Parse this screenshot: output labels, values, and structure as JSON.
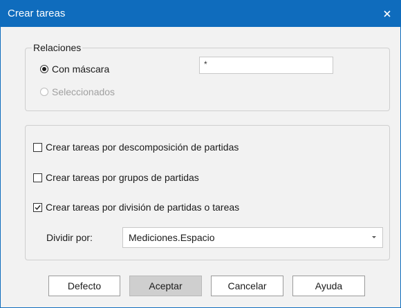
{
  "window": {
    "title": "Crear tareas",
    "close_icon": "close-icon",
    "titlebar_color": "#0f6cbd"
  },
  "relaciones": {
    "legend": "Relaciones",
    "options": [
      {
        "label": "Con máscara",
        "checked": true,
        "enabled": true
      },
      {
        "label": "Seleccionados",
        "checked": false,
        "enabled": false
      }
    ],
    "mask_value": "*"
  },
  "tareas": {
    "checkboxes": [
      {
        "label": "Crear tareas por descomposición de partidas",
        "checked": false
      },
      {
        "label": "Crear tareas por grupos de partidas",
        "checked": false
      },
      {
        "label": "Crear tareas por división de partidas o tareas",
        "checked": true
      }
    ],
    "dividir_label": "Dividir por:",
    "dividir_value": "Mediciones.Espacio"
  },
  "buttons": {
    "defecto": "Defecto",
    "aceptar": "Aceptar",
    "cancelar": "Cancelar",
    "ayuda": "Ayuda"
  }
}
